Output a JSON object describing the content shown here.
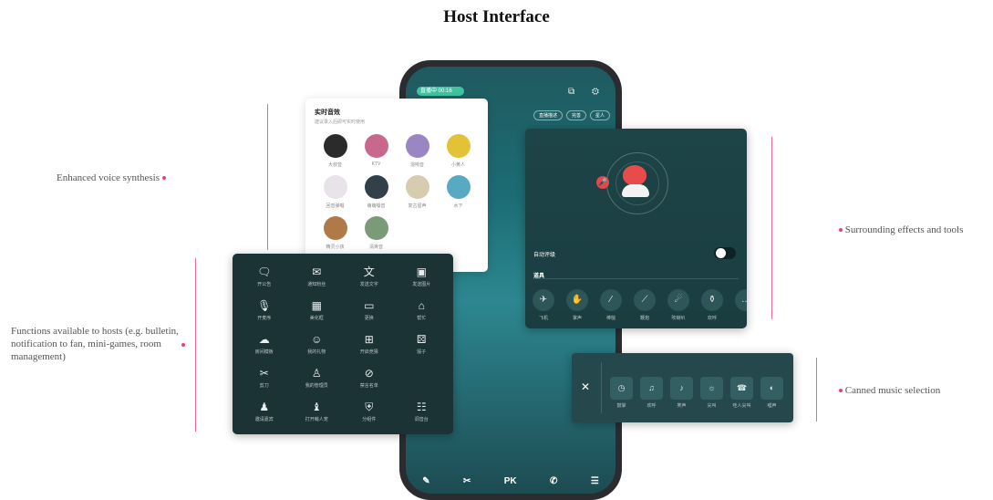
{
  "page_title": "Host Interface",
  "callouts": {
    "voice": "Enhanced voice synthesis",
    "functions": "Functions available to hosts (e.g. bulletin, notification to fan, mini-games, room management)",
    "effects": "Surrounding effects and tools",
    "music": "Canned music selection"
  },
  "phone": {
    "live_pill": "直播中 00:16",
    "top_icons": "⧉ ⚙",
    "chips": [
      "直播描述",
      "完善",
      "星人"
    ],
    "bottom_bar": [
      "✎",
      "✂",
      "PK",
      "✆",
      "☰"
    ]
  },
  "voice_card": {
    "title": "实时音效",
    "subtitle": "建议录入后即可实时使用",
    "items": [
      {
        "label": "大叔音",
        "color": "#2b2b2b"
      },
      {
        "label": "KTV",
        "color": "#c9688d"
      },
      {
        "label": "混响音",
        "color": "#9b86c4"
      },
      {
        "label": "小黄人",
        "color": "#e3c236"
      },
      {
        "label": "回音弹唱",
        "color": "#e8e3e8"
      },
      {
        "label": "萌萌嗓音",
        "color": "#33404a"
      },
      {
        "label": "复古留声",
        "color": "#d8ccb0"
      },
      {
        "label": "水下",
        "color": "#58a9c2"
      },
      {
        "label": "精灵小孩",
        "color": "#b07a48"
      },
      {
        "label": "清爽音",
        "color": "#7b9b78"
      }
    ]
  },
  "functions_panel": {
    "items": [
      {
        "icon": "🗨",
        "label": "开公告",
        "name": "bulletin-icon"
      },
      {
        "icon": "✉",
        "label": "通知粉丝",
        "name": "mail-icon"
      },
      {
        "icon": "文",
        "label": "发送文字",
        "name": "text-icon"
      },
      {
        "icon": "▣",
        "label": "发送图片",
        "name": "image-icon"
      },
      {
        "icon": "🎙",
        "label": "开麦序",
        "name": "mic-icon"
      },
      {
        "icon": "▦",
        "label": "美化框",
        "name": "frame-icon"
      },
      {
        "icon": "▭",
        "label": "更换",
        "name": "calendar-icon"
      },
      {
        "icon": "⌂",
        "label": "帮忙",
        "name": "hat-icon"
      },
      {
        "icon": "☁",
        "label": "房间模板",
        "name": "template-icon"
      },
      {
        "icon": "☺",
        "label": "我的礼物",
        "name": "smile-icon"
      },
      {
        "icon": "⊞",
        "label": "开启竞猜",
        "name": "grid-icon"
      },
      {
        "icon": "⚄",
        "label": "骰子",
        "name": "dice-icon"
      },
      {
        "icon": "✂",
        "label": "剪刀",
        "name": "scissors-icon"
      },
      {
        "icon": "♙",
        "label": "我的管理员",
        "name": "admin-icon"
      },
      {
        "icon": "⊘",
        "label": "禁言名单",
        "name": "ban-icon"
      },
      {
        "icon": "",
        "label": "",
        "name": "empty-slot"
      },
      {
        "icon": "♟",
        "label": "邀请嘉宾",
        "name": "invite-icon"
      },
      {
        "icon": "♝",
        "label": "打开萌人宠",
        "name": "pet-icon"
      },
      {
        "icon": "⛨",
        "label": "分组件",
        "name": "shield-icon"
      },
      {
        "icon": "☷",
        "label": "调音台",
        "name": "mixer-icon"
      }
    ]
  },
  "effects_panel": {
    "toggle_label": "自动评级",
    "tools_title": "道具",
    "tools": [
      {
        "icon": "✈",
        "label": "飞机"
      },
      {
        "icon": "✋",
        "label": "掌声"
      },
      {
        "icon": "⁄",
        "label": "棒槌"
      },
      {
        "icon": "⟋",
        "label": "鞭炮"
      },
      {
        "icon": "☄",
        "label": "吹喇叭"
      },
      {
        "icon": "⚱",
        "label": "欢呼"
      },
      {
        "icon": "…",
        "label": ""
      }
    ]
  },
  "music_panel": {
    "close_icon": "✕",
    "tracks": [
      {
        "icon": "◷",
        "label": "鼓掌"
      },
      {
        "icon": "♫",
        "label": "欢呼"
      },
      {
        "icon": "♪",
        "label": "笑声"
      },
      {
        "icon": "☼",
        "label": "尖叫"
      },
      {
        "icon": "☎",
        "label": "哇人尖叫"
      },
      {
        "icon": "◐",
        "label": "嘘声"
      }
    ]
  }
}
